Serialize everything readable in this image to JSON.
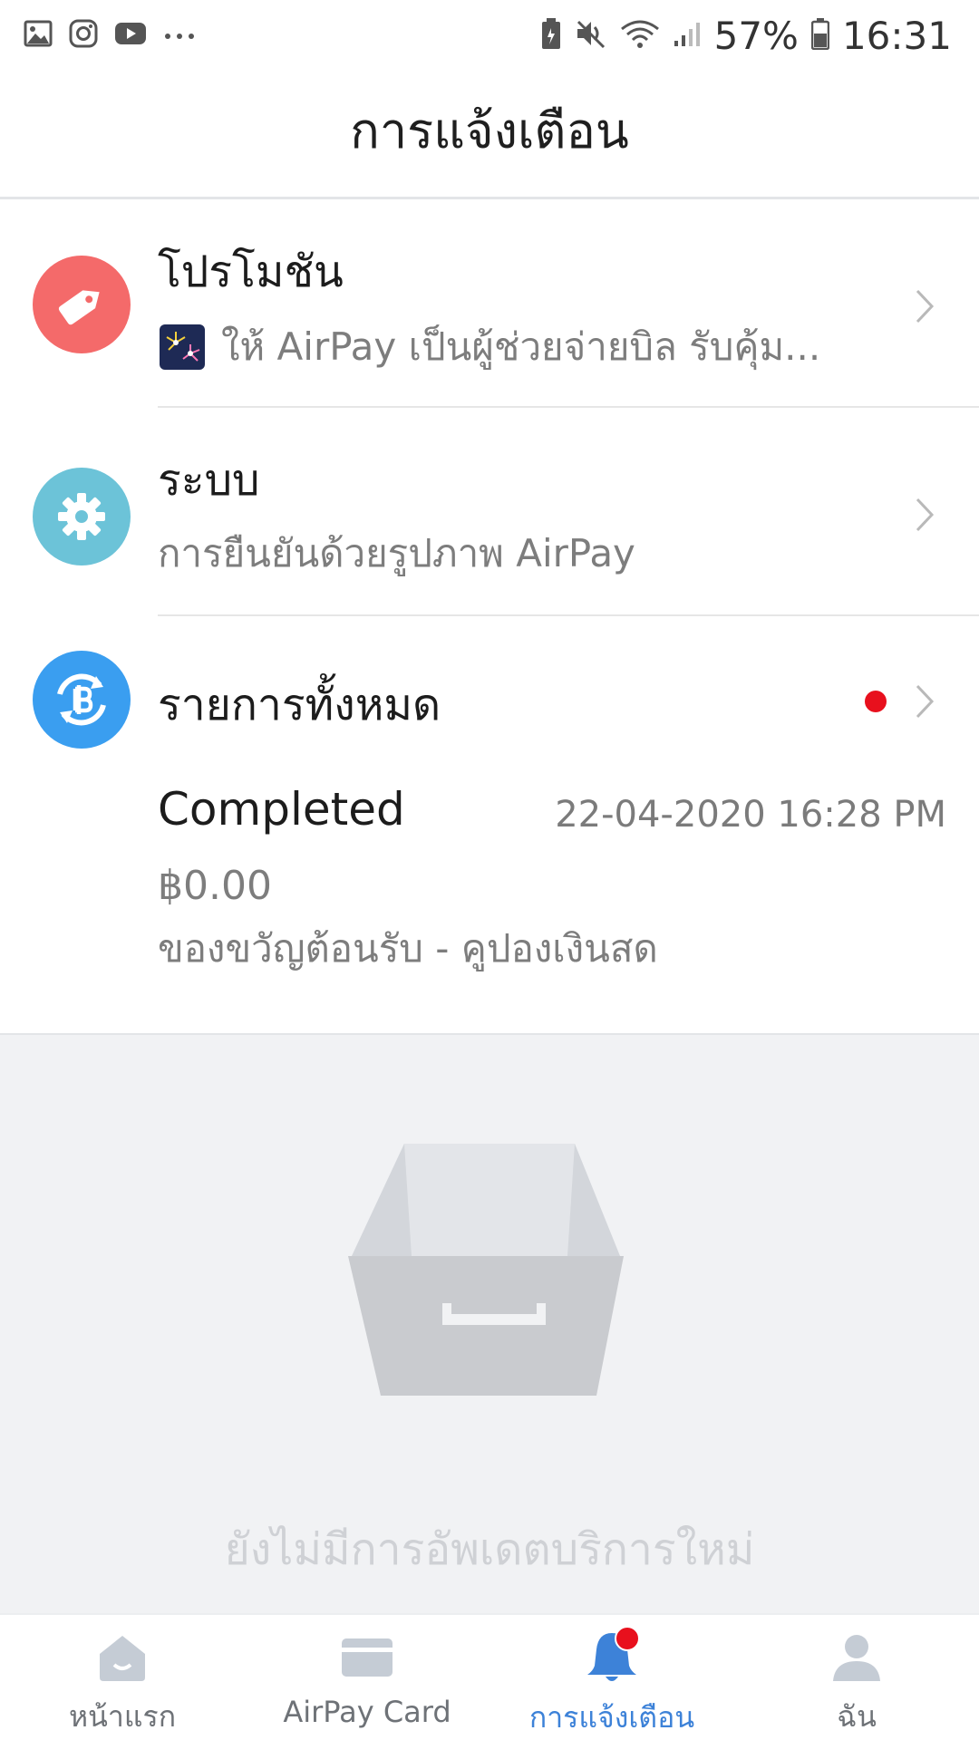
{
  "status_bar": {
    "battery": "57%",
    "time": "16:31",
    "left_icons": [
      "gallery-icon",
      "instagram-icon",
      "youtube-icon",
      "more-dots-icon"
    ],
    "right_icons": [
      "battery-saver-icon",
      "mute-icon",
      "wifi-icon",
      "signal-icon",
      "battery-icon"
    ]
  },
  "header": {
    "title": "การแจ้งเตือน"
  },
  "notifications": {
    "promotion": {
      "title": "โปรโมชัน",
      "subtitle": "ให้ AirPay เป็นผู้ช่วยจ่ายบิล รับคุ้ม...",
      "icon": "price-tag-icon",
      "color": "#f46a6a"
    },
    "system": {
      "title": "ระบบ",
      "subtitle": "การยืนยันด้วยรูปภาพ AirPay",
      "icon": "gear-icon",
      "color": "#6cc3d8"
    },
    "transactions": {
      "title": "รายการทั้งหมด",
      "icon": "baht-exchange-icon",
      "color": "#3a9ef0",
      "unread": true,
      "latest": {
        "status": "Completed",
        "datetime": "22-04-2020 16:28 PM",
        "amount": "฿0.00",
        "description": "ของขวัญต้อนรับ - คูปองเงินสด"
      }
    }
  },
  "empty_state": {
    "message": "ยังไม่มีการอัพเดตบริการใหม่",
    "icon": "empty-box-icon"
  },
  "bottom_nav": {
    "items": [
      {
        "label": "หน้าแรก",
        "icon": "home-icon",
        "active": false
      },
      {
        "label": "AirPay Card",
        "icon": "card-icon",
        "active": false
      },
      {
        "label": "การแจ้งเตือน",
        "icon": "bell-icon",
        "active": true,
        "badge": true
      },
      {
        "label": "ฉัน",
        "icon": "person-icon",
        "active": false
      }
    ]
  },
  "colors": {
    "accent": "#3d82d8",
    "badge": "#e8101d",
    "nav_inactive_icon": "#c5ccd5"
  }
}
